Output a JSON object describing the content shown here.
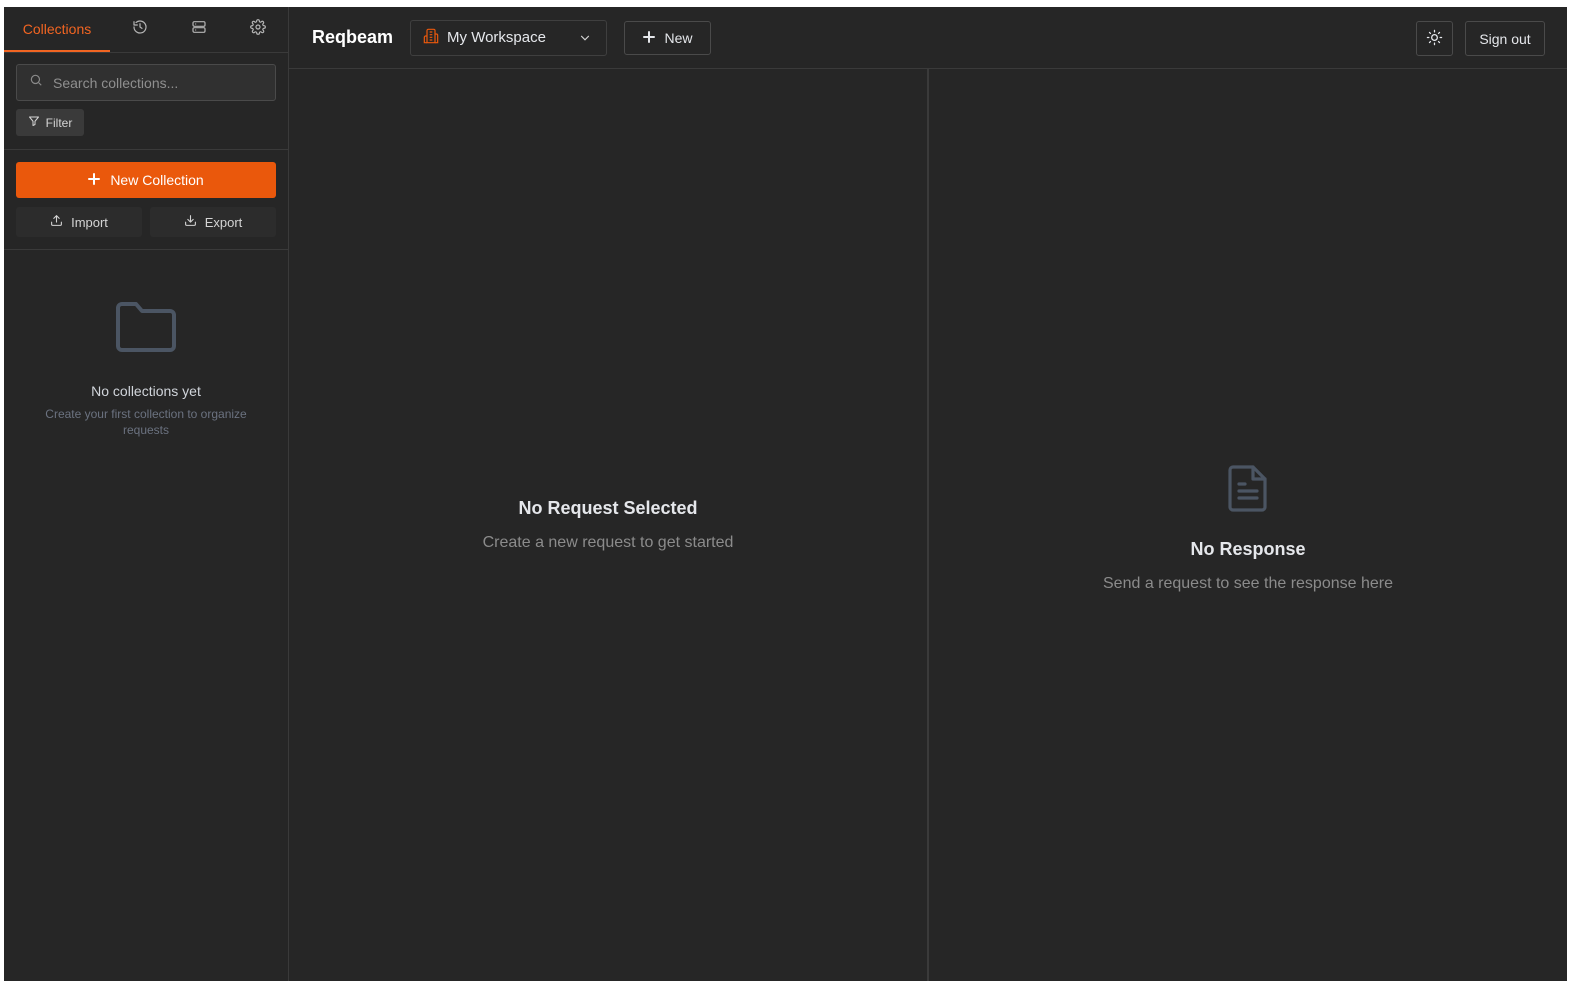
{
  "sidebar": {
    "tabs": {
      "collections": "Collections",
      "icons": [
        "history-icon",
        "environments-icon",
        "settings-icon"
      ]
    },
    "search": {
      "placeholder": "Search collections...",
      "value": ""
    },
    "filter_label": "Filter",
    "new_collection_label": "New Collection",
    "import_label": "Import",
    "export_label": "Export",
    "empty": {
      "title": "No collections yet",
      "subtitle": "Create your first collection to organize requests"
    }
  },
  "header": {
    "app_title": "Reqbeam",
    "workspace": "My Workspace",
    "new_label": "New",
    "sign_out_label": "Sign out"
  },
  "request_pane": {
    "title": "No Request Selected",
    "subtitle": "Create a new request to get started"
  },
  "response_pane": {
    "title": "No Response",
    "subtitle": "Send a request to see the response here"
  },
  "colors": {
    "accent": "#ea580c",
    "background": "#262626",
    "border": "#3a3a3a"
  }
}
